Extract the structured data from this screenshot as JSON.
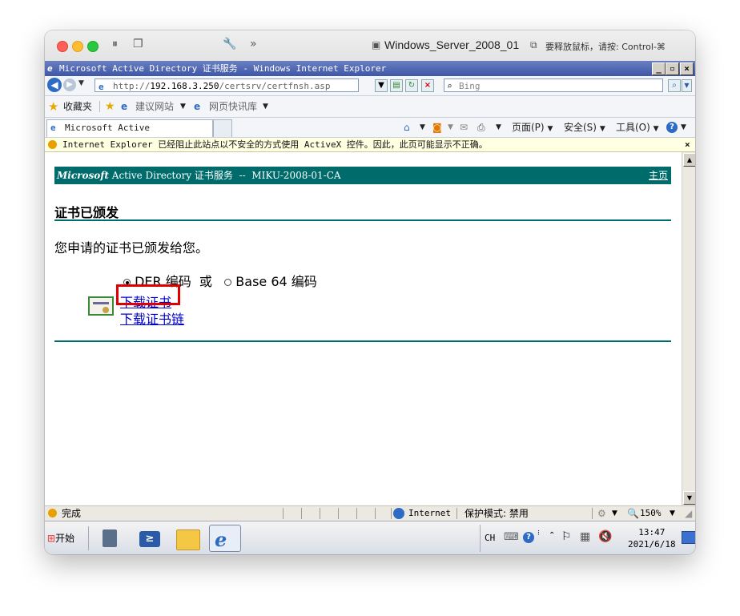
{
  "host_window": {
    "title": "Windows_Server_2008_01",
    "release_hint": "要释放鼠标，请按: Control-⌘"
  },
  "browser": {
    "window_title": "Microsoft Active Directory 证书服务 - Windows Internet Explorer",
    "address": {
      "scheme": "http://",
      "host": "192.168.3.250",
      "path": "/certsrv/certfnsh.asp"
    },
    "search_placeholder": "Bing",
    "favorites": {
      "label": "收藏夹",
      "suggested_sites": "建议网站",
      "web_slice": "网页快讯库"
    },
    "tab_label": "Microsoft Active Director...",
    "command_bar": {
      "page": "页面(P)",
      "safety": "安全(S)",
      "tools": "工具(O)"
    },
    "infobar_text": "Internet Explorer 已经阻止此站点以不安全的方式使用 ActiveX 控件。因此，此页可能显示不正确。",
    "status": {
      "left_text": "完成",
      "zone": "Internet",
      "protected_mode": "保护模式: 禁用",
      "zoom": "150%"
    }
  },
  "page": {
    "banner_brand": "Microsoft",
    "banner_text": "Active Directory 证书服务  --  MIKU-2008-01-CA",
    "home_link": "主页",
    "heading": "证书已颁发",
    "message": "您申请的证书已颁发给您。",
    "encoding": {
      "option_der": "DER 编码",
      "or_text": "或",
      "option_base64": "Base 64 编码",
      "selected": "DER"
    },
    "download_cert_link": "下载证书",
    "download_chain_link": "下载证书链"
  },
  "taskbar": {
    "start_label": "开始",
    "lang": "CH",
    "time": "13:47",
    "date": "2021/6/18"
  },
  "colors": {
    "banner": "#006b6b",
    "title_bar": "#3e57a8",
    "link": "#0000cc",
    "highlight_box": "#e00000"
  }
}
